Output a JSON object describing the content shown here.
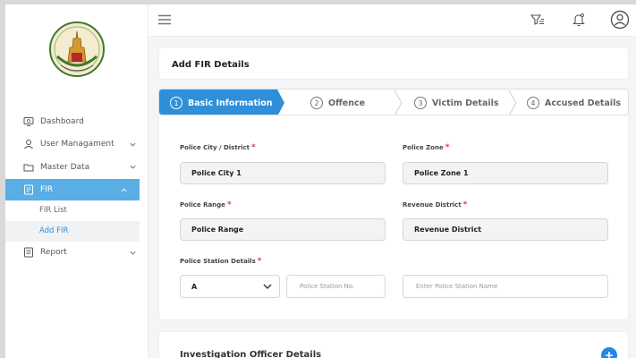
{
  "sidebar": {
    "items": [
      {
        "label": "Dashboard",
        "icon": "dashboard-icon"
      },
      {
        "label": "User Managament",
        "icon": "user-icon"
      },
      {
        "label": "Master Data",
        "icon": "folder-icon"
      },
      {
        "label": "FIR",
        "icon": "fir-icon"
      },
      {
        "label": "Report",
        "icon": "report-icon"
      }
    ],
    "sub_items": [
      {
        "label": "FIR List"
      },
      {
        "label": "Add FIR"
      }
    ]
  },
  "topbar": {
    "icons": [
      "menu-icon",
      "filter-icon",
      "bell-icon",
      "profile-icon"
    ]
  },
  "page": {
    "title": "Add FIR Details"
  },
  "steps": [
    {
      "num": "1",
      "label": "Basic Information"
    },
    {
      "num": "2",
      "label": "Offence"
    },
    {
      "num": "3",
      "label": "Victim Details"
    },
    {
      "num": "4",
      "label": "Accused Details"
    }
  ],
  "form": {
    "police_city": {
      "label": "Police City / District",
      "value": "Police City 1"
    },
    "police_zone": {
      "label": "Police Zone",
      "value": "Police Zone 1"
    },
    "police_range": {
      "label": "Police Range",
      "value": "Police Range"
    },
    "revenue_district": {
      "label": "Revenue District",
      "value": "Revenue District"
    },
    "station": {
      "label": "Police Station Details",
      "select_value": "A",
      "number_placeholder": "Police Station No.",
      "name_placeholder": "Enter Police Station Name"
    },
    "required_mark": "*"
  },
  "investigation": {
    "title": "Investigation Officer Details"
  },
  "colors": {
    "accent": "#2f8fd8",
    "active_nav": "#5aaee6",
    "required": "#e03a3a",
    "plus_button": "#2585e8"
  }
}
